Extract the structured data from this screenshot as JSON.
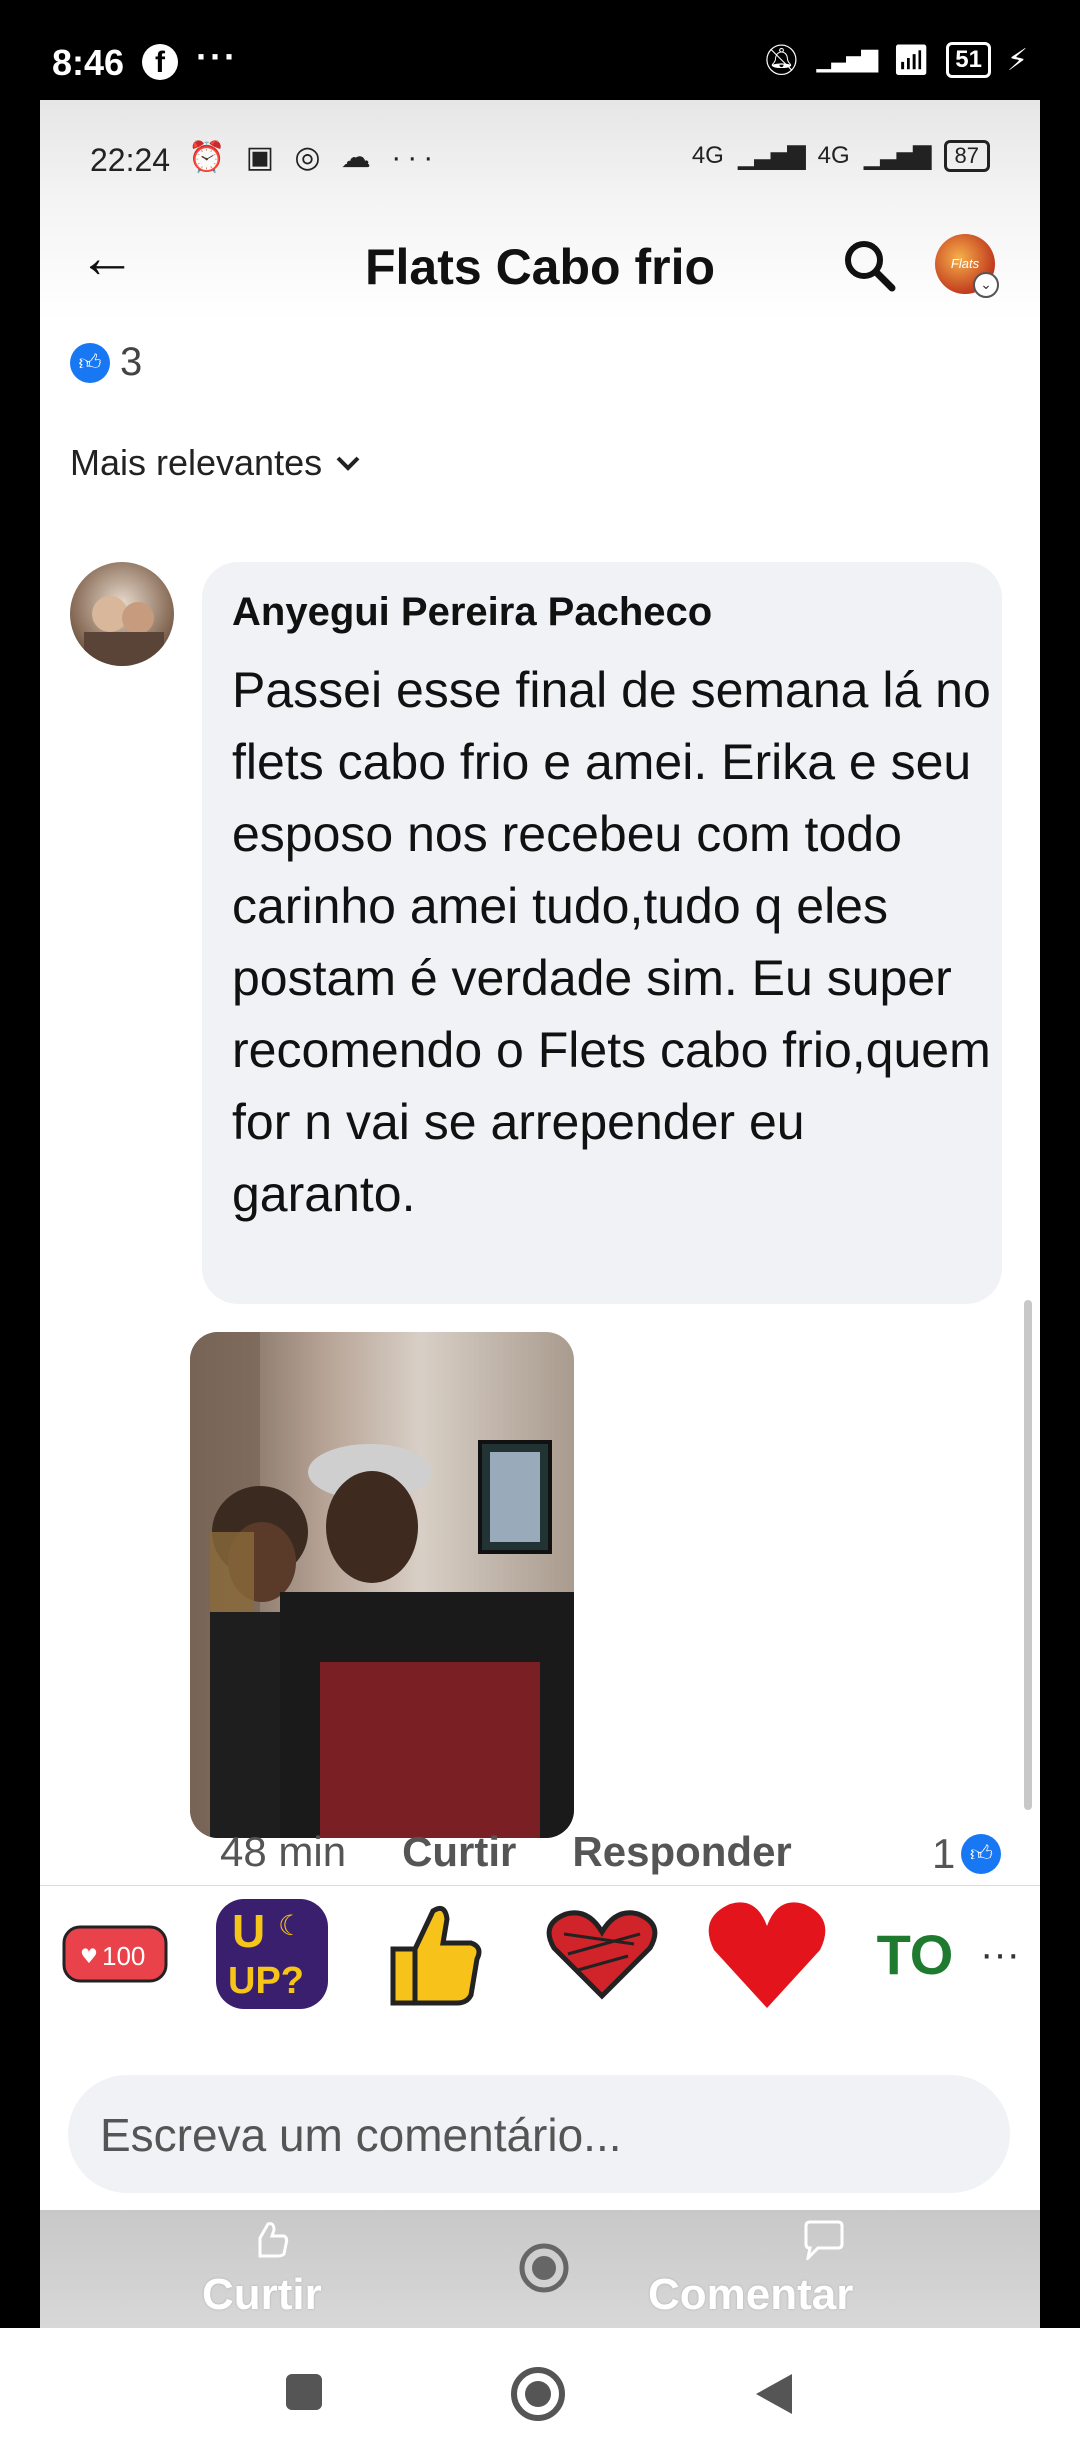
{
  "outer_status": {
    "time": "8:46",
    "dots": "···",
    "battery": "51"
  },
  "inner_status": {
    "time": "22:24",
    "icons": "⏰ ▣ ◎ ☁ ···",
    "net1": "4G",
    "net2": "4G",
    "battery": "87"
  },
  "header": {
    "title": "Flats Cabo frio",
    "page_avatar_text": "Flats"
  },
  "reactions": {
    "count": "3"
  },
  "sort": {
    "label": "Mais relevantes"
  },
  "comment": {
    "author": "Anyegui Pereira Pacheco",
    "text": "Passei esse final de semana lá no flets cabo frio e amei. Erika e seu esposo nos recebeu com todo carinho amei tudo,tudo q eles postam é verdade sim. Eu super recomendo o Flets cabo frio,quem for n vai se arrepender eu garanto.",
    "time": "48 min",
    "like_action": "Curtir",
    "reply_action": "Responder",
    "like_count": "1"
  },
  "stickers": {
    "badge_100": "100",
    "ucup_top": "U",
    "ucup_bottom": "UP?",
    "to_text": "TO",
    "more": "···"
  },
  "composer": {
    "placeholder": "Escreva um comentário..."
  },
  "bottom_bar": {
    "like": "Curtir",
    "comment": "Comentar"
  }
}
